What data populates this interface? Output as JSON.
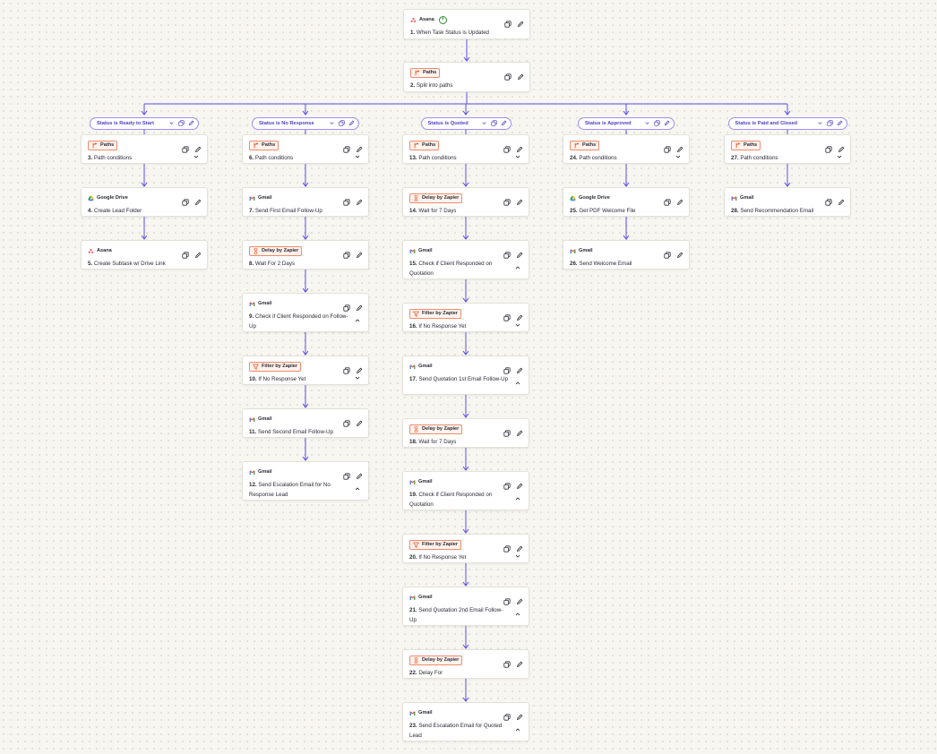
{
  "colors": {
    "connector": "#5b4de6",
    "path_label_border": "#9c8ff0",
    "badge_border": "#f08a6b",
    "badge_bg": "#fff3ee"
  },
  "icons": {
    "duplicate": "duplicate-icon",
    "edit": "pencil-icon",
    "chevron_down": "chevron-down-icon",
    "chevron_up": "chevron-up-icon"
  },
  "trigger": {
    "app": "Asana",
    "step": "1.",
    "title": "When Task Status is Updated"
  },
  "split": {
    "app": "Paths",
    "step": "2.",
    "title": "Split into paths"
  },
  "paths": [
    {
      "label": "Status is Ready to Start",
      "steps": [
        {
          "app": "Paths",
          "step": "3.",
          "title": "Path conditions",
          "chevron": "down"
        },
        {
          "app": "Google Drive",
          "step": "4.",
          "title": "Create Lead Folder"
        },
        {
          "app": "Asana",
          "step": "5.",
          "title": "Create Subtask w/ Drive Link"
        }
      ]
    },
    {
      "label": "Status is No Response",
      "steps": [
        {
          "app": "Paths",
          "step": "6.",
          "title": "Path conditions",
          "chevron": "down"
        },
        {
          "app": "Gmail",
          "step": "7.",
          "title": "Send First Email Follow-Up"
        },
        {
          "app": "Delay by Zapier",
          "step": "8.",
          "title": "Wait For 2 Days"
        },
        {
          "app": "Gmail",
          "step": "9.",
          "title": "Check if Client Responded on Follow-Up",
          "chevron": "up"
        },
        {
          "app": "Filter by Zapier",
          "step": "10.",
          "title": "If No Response Yet",
          "chevron": "down"
        },
        {
          "app": "Gmail",
          "step": "11.",
          "title": "Send Second Email Follow-Up"
        },
        {
          "app": "Gmail",
          "step": "12.",
          "title": "Send Escalation Email for No Response Lead",
          "chevron": "up"
        }
      ]
    },
    {
      "label": "Status is Quoted",
      "steps": [
        {
          "app": "Paths",
          "step": "13.",
          "title": "Path conditions",
          "chevron": "down"
        },
        {
          "app": "Delay by Zapier",
          "step": "14.",
          "title": "Wait for 7 Days"
        },
        {
          "app": "Gmail",
          "step": "15.",
          "title": "Check if Client Responded on Quotation",
          "chevron": "up"
        },
        {
          "app": "Filter by Zapier",
          "step": "16.",
          "title": "If No Response Yet",
          "chevron": "down"
        },
        {
          "app": "Gmail",
          "step": "17.",
          "title": "Send Quotation 1st Email Follow-Up",
          "chevron": "up"
        },
        {
          "app": "Delay by Zapier",
          "step": "18.",
          "title": "Wait for 7 Days"
        },
        {
          "app": "Gmail",
          "step": "19.",
          "title": "Check if Client Responded on Quotation",
          "chevron": "up"
        },
        {
          "app": "Filter by Zapier",
          "step": "20.",
          "title": "If No Response Yet",
          "chevron": "down"
        },
        {
          "app": "Gmail",
          "step": "21.",
          "title": "Send Quotation 2nd Email Follow-Up",
          "chevron": "up"
        },
        {
          "app": "Delay by Zapier",
          "step": "22.",
          "title": "Delay For"
        },
        {
          "app": "Gmail",
          "step": "23.",
          "title": "Send Escalation Email for Quoted Lead",
          "chevron": "up"
        }
      ]
    },
    {
      "label": "Status is Approved",
      "steps": [
        {
          "app": "Paths",
          "step": "24.",
          "title": "Path conditions",
          "chevron": "down"
        },
        {
          "app": "Google Drive",
          "step": "25.",
          "title": "Get PDF Welcome File"
        },
        {
          "app": "Gmail",
          "step": "26.",
          "title": "Send Welcome Email"
        }
      ]
    },
    {
      "label": "Status is Paid and Closed",
      "steps": [
        {
          "app": "Paths",
          "step": "27.",
          "title": "Path conditions",
          "chevron": "down"
        },
        {
          "app": "Gmail",
          "step": "28.",
          "title": "Send Recommendation Email"
        }
      ]
    }
  ]
}
